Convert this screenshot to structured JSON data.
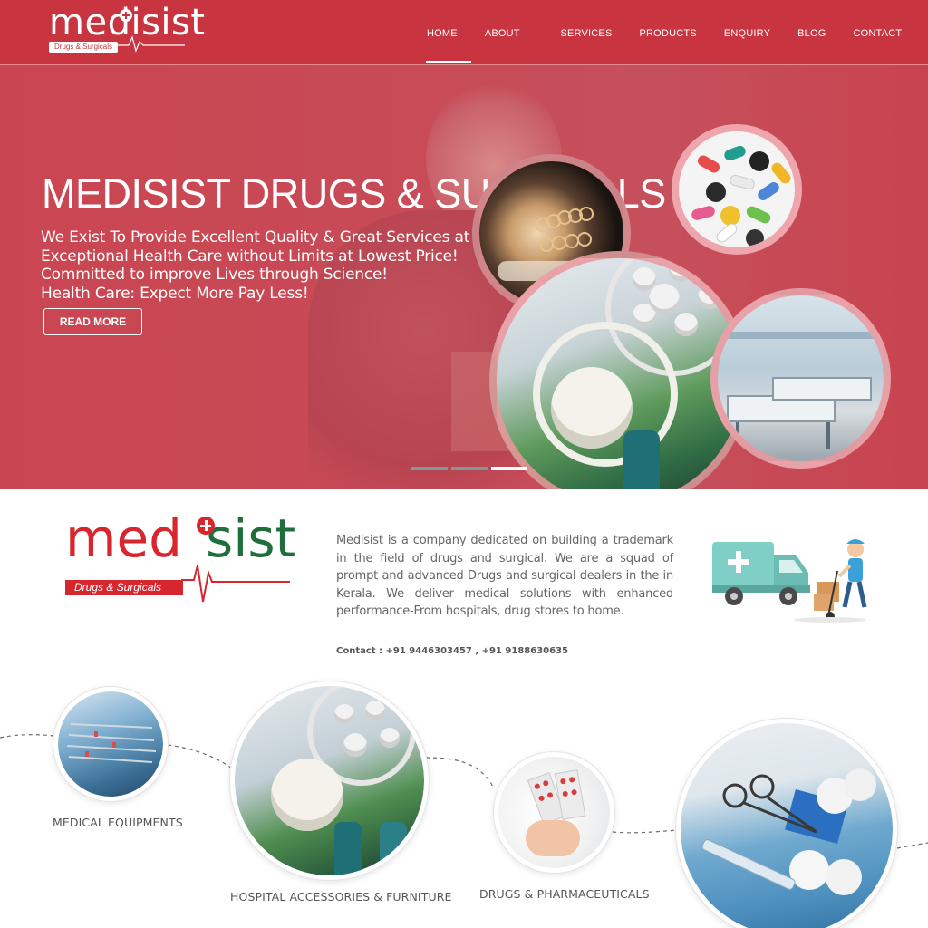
{
  "brand": {
    "logo_word": "medisist",
    "logo_tagline": "Drugs & Surgicals",
    "colors": {
      "primary": "#c8343f",
      "logo_red": "#d8262f",
      "logo_green": "#1f6e3b"
    }
  },
  "nav": {
    "items": [
      {
        "label": "HOME",
        "active": true
      },
      {
        "label": "ABOUT US",
        "active": false
      },
      {
        "label": "SERVICES",
        "active": false
      },
      {
        "label": "PRODUCTS",
        "active": false
      },
      {
        "label": "ENQUIRY",
        "active": false
      },
      {
        "label": "BLOG",
        "active": false
      },
      {
        "label": "CONTACT US",
        "active": false
      }
    ]
  },
  "hero": {
    "title": "MEDISIST DRUGS & SURGICALS",
    "lines": [
      "We Exist To Provide Excellent Quality & Great Services at Minimal Amount!",
      "Exceptional Health Care without Limits at Lowest Price!",
      "Committed to improve Lives through Science!",
      "Health Care: Expect More Pay Less!"
    ],
    "cta_label": "READ MORE",
    "slider": {
      "total": 3,
      "active": 3
    }
  },
  "about": {
    "logo_left": "med",
    "logo_right": "sist",
    "logo_tagline": "Drugs & Surgicals",
    "text": "Medisist is a company dedicated on building a trademark in the field of drugs and surgical. We are a squad of prompt and advanced Drugs and surgical dealers in the in Kerala. We deliver medical solutions with enhanced performance-From hospitals, drug stores to home.",
    "contact": "Contact : +91 9446303457 , +91 9188630635",
    "illustration_icon": "delivery-truck-icon"
  },
  "categories": [
    {
      "label": "MEDICAL EQUIPMENTS"
    },
    {
      "label": "HOSPITAL ACCESSORIES & FURNITURE"
    },
    {
      "label": "DRUGS & PHARMACEUTICALS"
    },
    {
      "label": ""
    }
  ]
}
